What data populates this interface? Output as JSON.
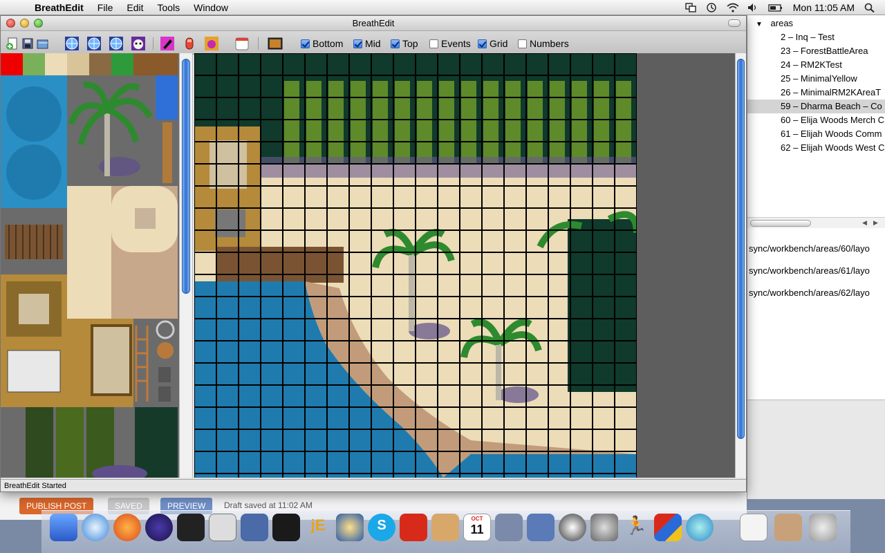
{
  "menubar": {
    "apple_glyph": "",
    "app_name": "BreathEdit",
    "menus": [
      "File",
      "Edit",
      "Tools",
      "Window"
    ],
    "clock": "Mon 11:05 AM"
  },
  "window": {
    "title": "BreathEdit",
    "status": "BreathEdit Started"
  },
  "toolbar": {
    "layers": [
      {
        "label": "Bottom",
        "checked": true
      },
      {
        "label": "Mid",
        "checked": true
      },
      {
        "label": "Top",
        "checked": true
      },
      {
        "label": "Events",
        "checked": false
      },
      {
        "label": "Grid",
        "checked": true
      },
      {
        "label": "Numbers",
        "checked": false
      }
    ]
  },
  "areas": {
    "root_label": "areas",
    "items": [
      "2 – Inq – Test",
      "23 – ForestBattleArea",
      "24 – RM2KTest",
      "25 – MinimalYellow",
      "26 – MinimalRM2KAreaT",
      "59 – Dharma Beach – Co",
      "60 – Elija Woods Merch C",
      "61 – Elijah Woods Comm",
      "62 – Elijah Woods West C"
    ],
    "selected_index": 5,
    "paths": [
      "sync/workbench/areas/60/layo",
      "sync/workbench/areas/61/layo",
      "sync/workbench/areas/62/layo"
    ]
  },
  "backdrop": {
    "publish": "PUBLISH POST",
    "saved": "SAVED",
    "preview": "PREVIEW",
    "draft": "Draft saved at 11:02 AM"
  },
  "dock": {
    "calendar_month": "OCT",
    "calendar_day": "11"
  },
  "colors": {
    "selection": "#d4d4d4",
    "water": "#1f7bae",
    "sand": "#ecdcb8",
    "forest": "#0f3a2c",
    "checkbox_on": "#3d7ee6"
  }
}
